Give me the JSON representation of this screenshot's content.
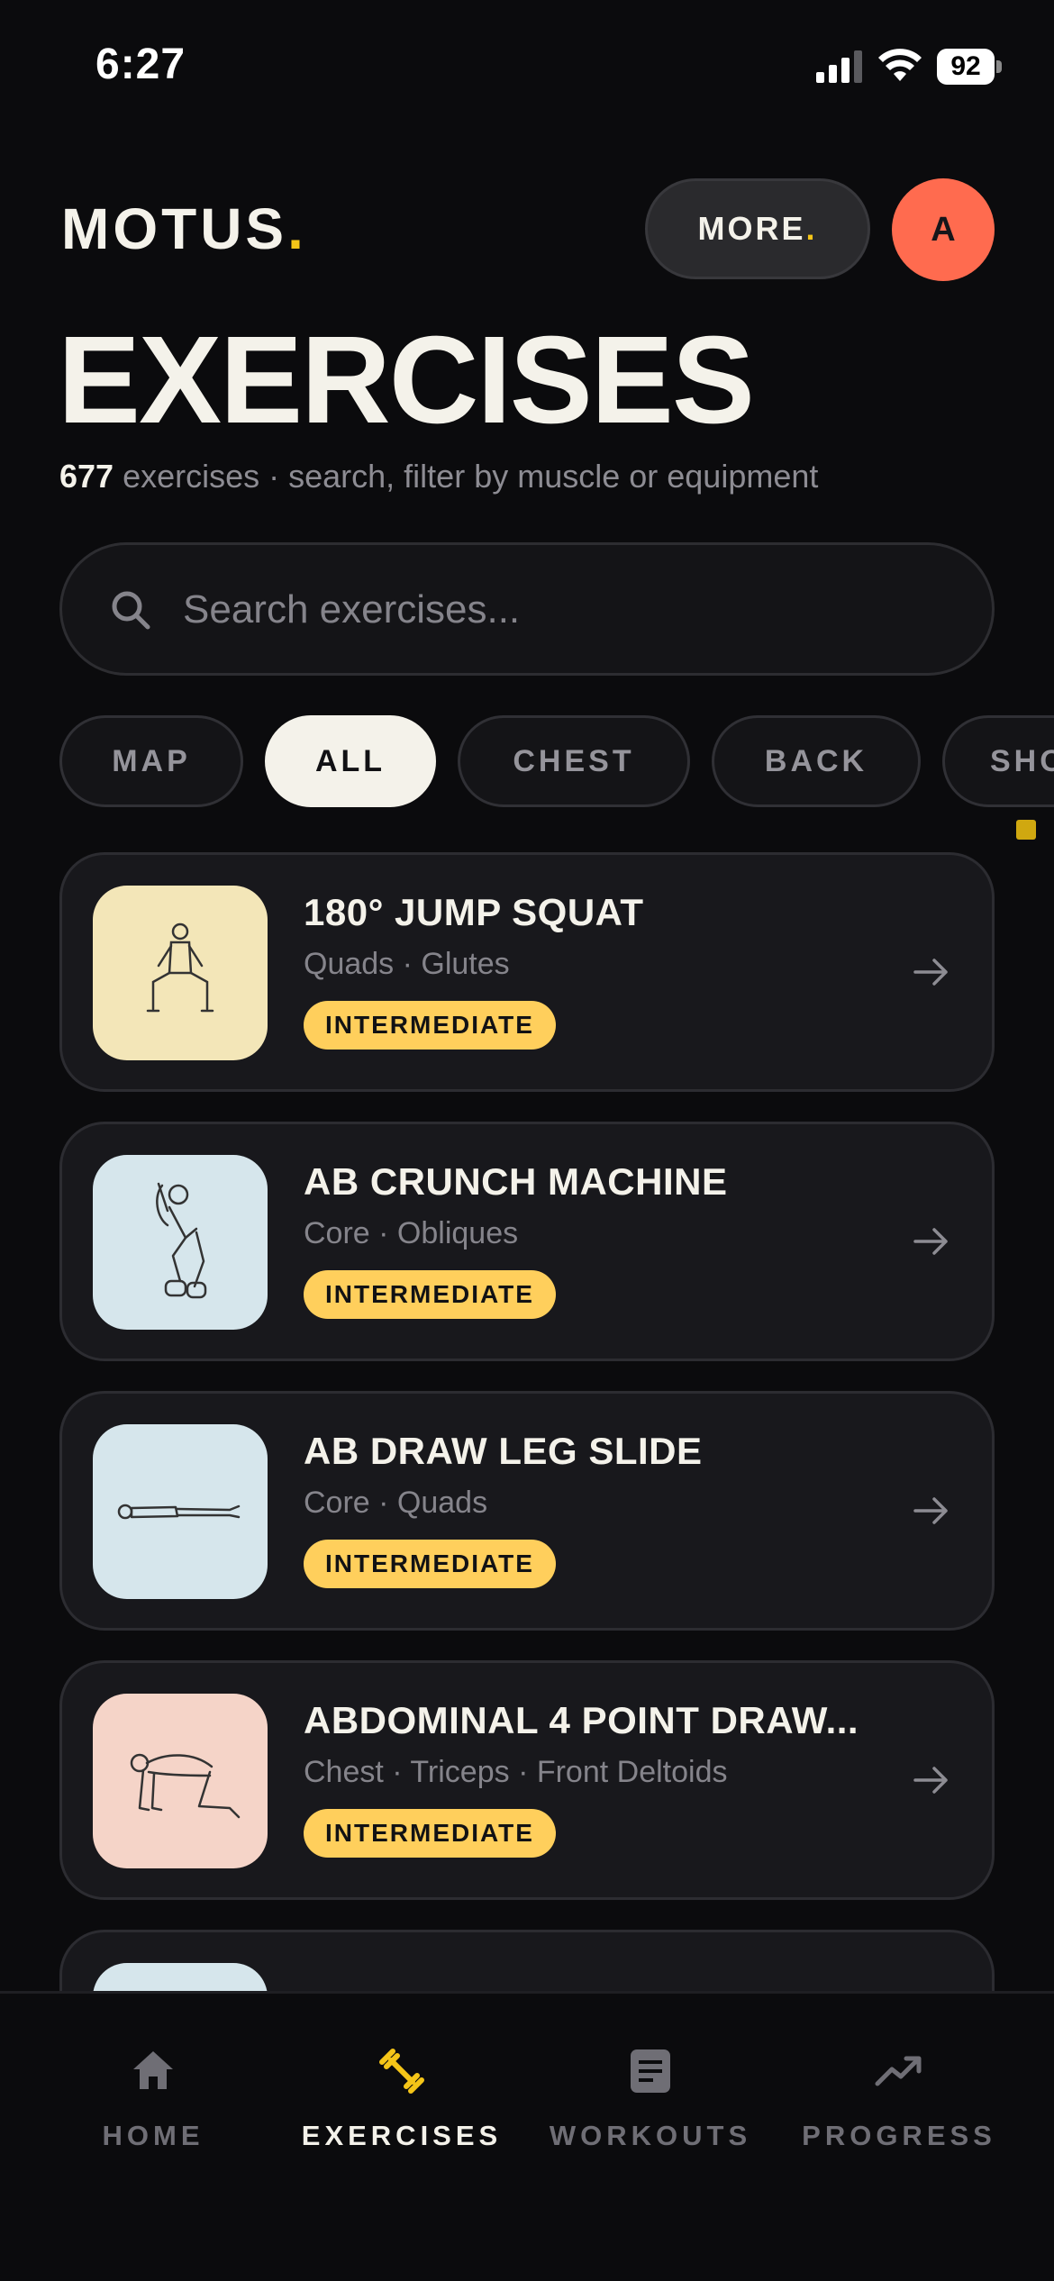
{
  "status_bar": {
    "time": "6:27",
    "battery": "92"
  },
  "header": {
    "logo_text": "MOTUS",
    "logo_dot": ".",
    "more_label": "MORE",
    "more_dot": ".",
    "avatar_initial": "A"
  },
  "title": "EXERCISES",
  "subtitle": {
    "count": "677",
    "text": " exercises · search, filter by muscle or equipment"
  },
  "search": {
    "placeholder": "Search exercises...",
    "value": ""
  },
  "filters": [
    {
      "label": "MAP",
      "active": false
    },
    {
      "label": "ALL",
      "active": true
    },
    {
      "label": "CHEST",
      "active": false
    },
    {
      "label": "BACK",
      "active": false
    },
    {
      "label": "SHO",
      "active": false
    }
  ],
  "exercises": [
    {
      "name": "180° JUMP SQUAT",
      "muscles": "Quads · Glutes",
      "level": "INTERMEDIATE",
      "thumb_color": "#f3e6b8"
    },
    {
      "name": "AB CRUNCH MACHINE",
      "muscles": "Core · Obliques",
      "level": "INTERMEDIATE",
      "thumb_color": "#d6e6ec"
    },
    {
      "name": "AB DRAW LEG SLIDE",
      "muscles": "Core · Quads",
      "level": "INTERMEDIATE",
      "thumb_color": "#d6e6ec"
    },
    {
      "name": "ABDOMINAL 4 POINT DRAW...",
      "muscles": "Chest · Triceps · Front Deltoids",
      "level": "INTERMEDIATE",
      "thumb_color": "#f5d4c8"
    },
    {
      "name": "",
      "muscles": "",
      "level": "",
      "thumb_color": "#d6e6ec"
    }
  ],
  "nav": [
    {
      "label": "HOME",
      "icon": "home-icon",
      "active": false
    },
    {
      "label": "EXERCISES",
      "icon": "dumbbell-icon",
      "active": true
    },
    {
      "label": "WORKOUTS",
      "icon": "document-icon",
      "active": false
    },
    {
      "label": "PROGRESS",
      "icon": "trending-up-icon",
      "active": false
    }
  ],
  "colors": {
    "accent": "#f5c518",
    "avatar": "#ff6b4f",
    "badge": "#ffcf5c",
    "background": "#0b0b0d",
    "card": "#18181c"
  }
}
